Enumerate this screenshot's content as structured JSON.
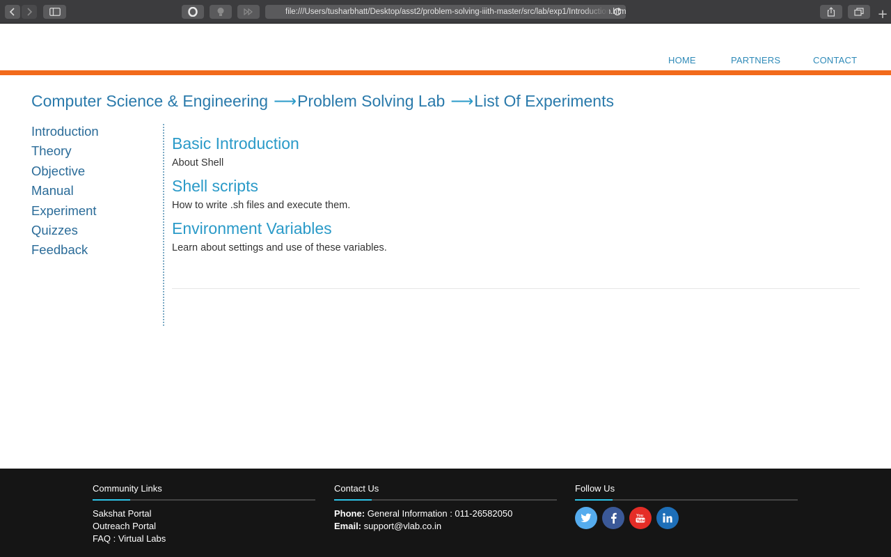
{
  "browser": {
    "url": "file:///Users/tusharbhatt/Desktop/asst2/problem-solving-iiith-master/src/lab/exp1/Introduction.html"
  },
  "nav": {
    "items": [
      "HOME",
      "PARTNERS",
      "CONTACT"
    ]
  },
  "breadcrumb": {
    "part1": "Computer Science & Engineering",
    "arrow": "⟶",
    "part2": "Problem Solving Lab",
    "part3": "List Of Experiments"
  },
  "sidebar": {
    "items": [
      "Introduction",
      "Theory",
      "Objective",
      "Manual",
      "Experiment",
      "Quizzes",
      "Feedback"
    ]
  },
  "main": {
    "sections": [
      {
        "heading": "Basic Introduction",
        "text": "About Shell"
      },
      {
        "heading": "Shell scripts",
        "text": "How to write .sh files and execute them."
      },
      {
        "heading": "Environment Variables",
        "text": "Learn about settings and use of these variables."
      }
    ]
  },
  "footer": {
    "community": {
      "title": "Community Links",
      "links": [
        "Sakshat Portal",
        "Outreach Portal",
        "FAQ : Virtual Labs"
      ]
    },
    "contact": {
      "title": "Contact Us",
      "phone_label": "Phone:",
      "phone_value": "General Information : 011-26582050",
      "email_label": "Email:",
      "email_value": "support@vlab.co.in"
    },
    "follow": {
      "title": "Follow Us",
      "icons": [
        {
          "name": "twitter-icon",
          "color": "#55acee"
        },
        {
          "name": "facebook-icon",
          "color": "#3b5998"
        },
        {
          "name": "youtube-icon",
          "color": "#e52d27"
        },
        {
          "name": "linkedin-icon",
          "color": "#1e6fb8"
        }
      ]
    }
  },
  "colors": {
    "accent_orange": "#f26a1b",
    "link_blue": "#2a9ac8",
    "footer_bg": "#151515"
  }
}
